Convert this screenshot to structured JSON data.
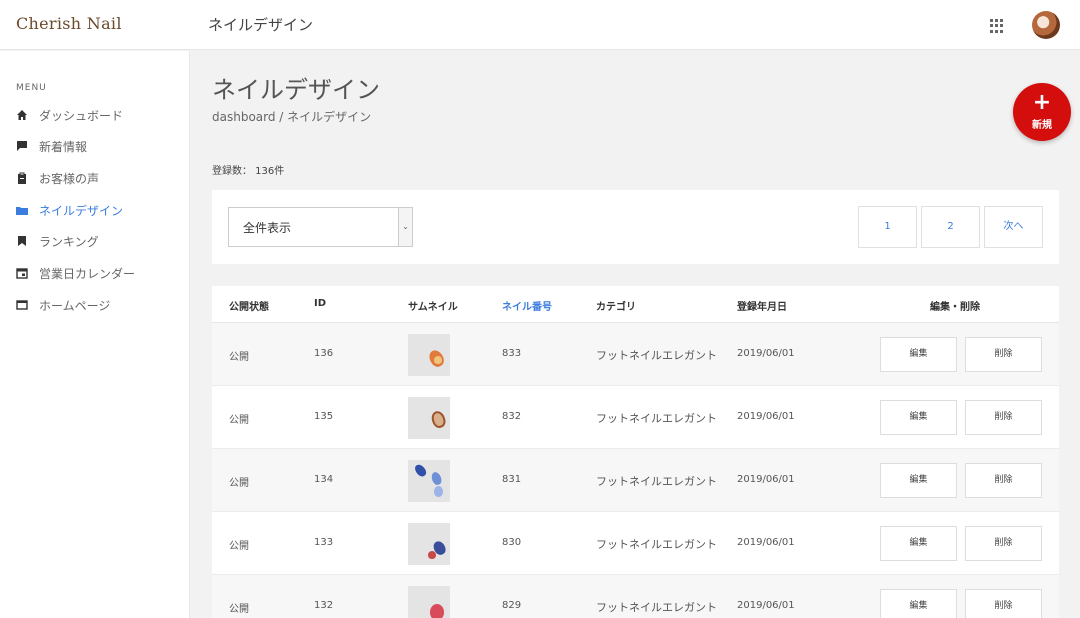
{
  "header": {
    "logo": "Cherish Nail",
    "title": "ネイルデザイン"
  },
  "sidebar": {
    "menu_label": "MENU",
    "items": [
      {
        "label": "ダッシュボード",
        "icon": "home-icon"
      },
      {
        "label": "新着情報",
        "icon": "comment-icon"
      },
      {
        "label": "お客様の声",
        "icon": "clipboard-icon"
      },
      {
        "label": "ネイルデザイン",
        "icon": "folder-icon",
        "active": true
      },
      {
        "label": "ランキング",
        "icon": "bookmark-icon"
      },
      {
        "label": "営業日カレンダー",
        "icon": "calendar-icon"
      },
      {
        "label": "ホームページ",
        "icon": "browser-icon"
      }
    ]
  },
  "main": {
    "title": "ネイルデザイン",
    "breadcrumb": "dashboard / ネイルデザイン",
    "count": "登録数： 136件",
    "fab": {
      "plus": "+",
      "label": "新規"
    }
  },
  "filter": {
    "select_value": "全件表示",
    "pagination": [
      "1",
      "2",
      "次へ"
    ]
  },
  "table": {
    "headers": [
      "公開状態",
      "ID",
      "サムネイル",
      "ネイル番号",
      "カテゴリ",
      "登録年月日",
      "編集・削除"
    ],
    "edit_label": "編集",
    "delete_label": "削除",
    "rows": [
      {
        "status": "公開",
        "id": "136",
        "number": "833",
        "category": "フットネイルエレガント",
        "date": "2019/06/01"
      },
      {
        "status": "公開",
        "id": "135",
        "number": "832",
        "category": "フットネイルエレガント",
        "date": "2019/06/01"
      },
      {
        "status": "公開",
        "id": "134",
        "number": "831",
        "category": "フットネイルエレガント",
        "date": "2019/06/01"
      },
      {
        "status": "公開",
        "id": "133",
        "number": "830",
        "category": "フットネイルエレガント",
        "date": "2019/06/01"
      },
      {
        "status": "公開",
        "id": "132",
        "number": "829",
        "category": "フットネイルエレガント",
        "date": "2019/06/01"
      }
    ]
  },
  "colors": {
    "accent": "#3b7ddd",
    "fab": "#d40d0d",
    "logo": "#6b4a2a"
  }
}
